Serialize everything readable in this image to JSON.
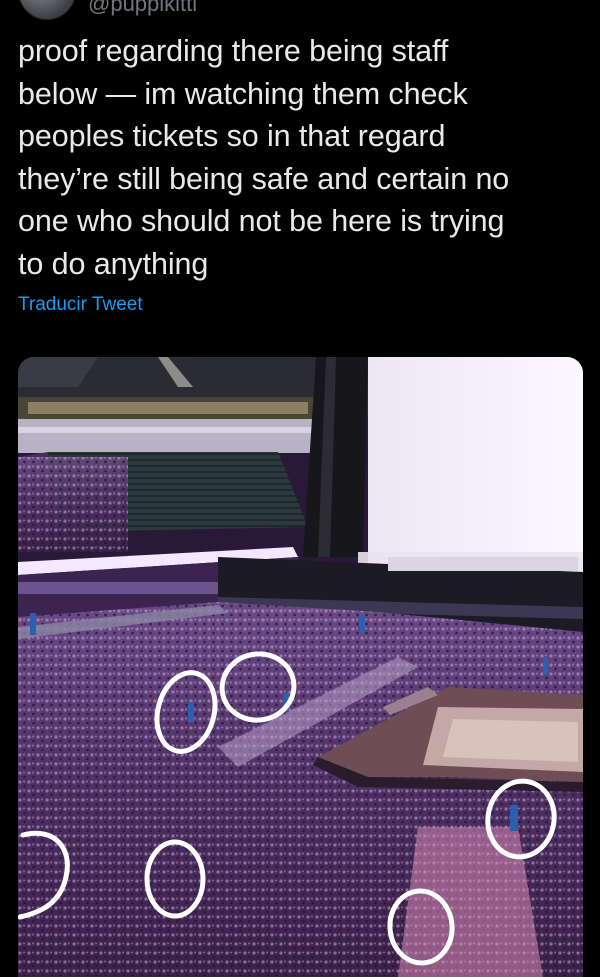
{
  "author": {
    "handle": "@puppikitti",
    "avatar_icon": "avatar"
  },
  "tweet": {
    "text": "proof regarding there being staff\nbelow — im watching them check\npeoples tickets so in that regard\nthey’re still being safe and certain no\none who should not be here is trying\nto do anything",
    "translate_label": "Traducir Tweet"
  },
  "media": {
    "type": "photo",
    "subject": "arena-concert-crowd",
    "annotation_color": "#ffffff",
    "annotation_count": 6
  },
  "colors": {
    "background": "#000000",
    "text": "#e7e9ea",
    "link": "#1d9bf0",
    "muted": "#71767b"
  }
}
